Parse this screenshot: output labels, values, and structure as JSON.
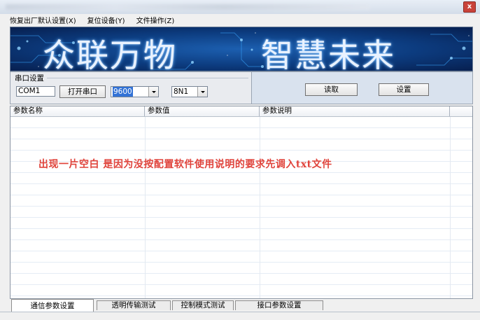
{
  "menu": {
    "items": [
      "恢复出厂默认设置(X)",
      "复位设备(Y)",
      "文件操作(Z)"
    ]
  },
  "window": {
    "close_glyph": "x"
  },
  "banner": {
    "left_text": "众联万物",
    "right_text": "智慧未来",
    "accent": "#0c3b7e"
  },
  "serial": {
    "group_label": "串口设置",
    "port_value": "COM1",
    "open_button": "打开串口",
    "baud_value": "9600",
    "format_value": "8N1"
  },
  "actions": {
    "read_button": "读取",
    "set_button": "设置"
  },
  "table": {
    "columns": [
      "参数名称",
      "参数值",
      "参数说明"
    ],
    "empty_message": "出现一片空白 是因为没按配置软件使用说明的要求先调入txt文件",
    "message_color": "#e0443c"
  },
  "tabs": [
    "通信参数设置",
    "透明传输测试",
    "控制模式测试",
    "接口参数设置"
  ],
  "icons": {
    "close": "close-icon",
    "dropdown": "chevron-down-icon"
  }
}
